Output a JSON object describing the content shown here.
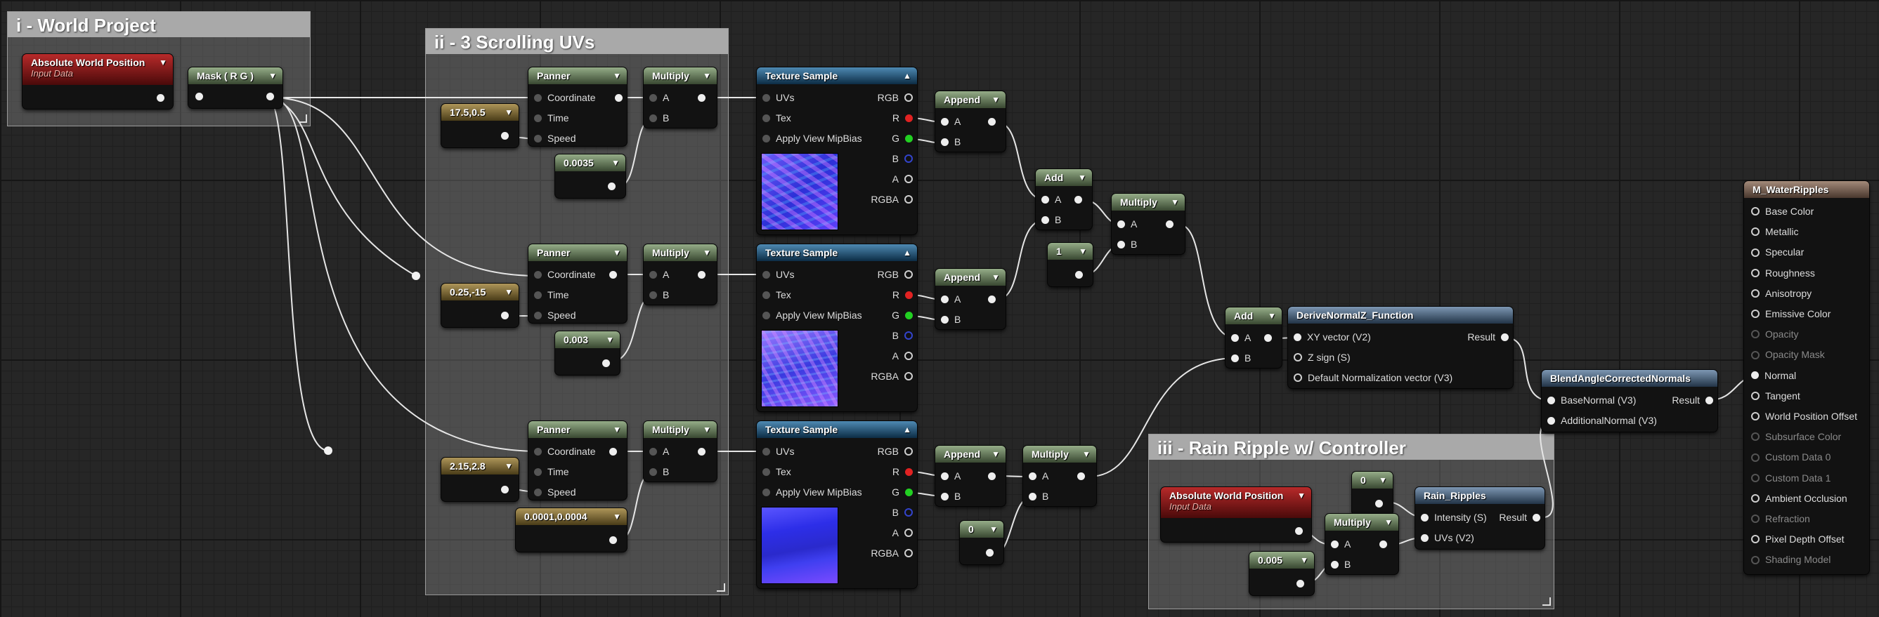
{
  "comments": {
    "world": "i - World Project",
    "scroll": "ii - 3 Scrolling UVs",
    "rain": "iii - Rain Ripple w/ Controller"
  },
  "labels": {
    "absolute_world_position": "Absolute World Position",
    "input_data": "Input Data",
    "mask": "Mask ( R G )",
    "panner": "Panner",
    "multiply": "Multiply",
    "texture_sample": "Texture Sample",
    "append": "Append",
    "add": "Add",
    "coordinate": "Coordinate",
    "time": "Time",
    "speed": "Speed",
    "a": "A",
    "b": "B",
    "uvs": "UVs",
    "tex": "Tex",
    "apply_view_mipbias": "Apply View MipBias",
    "rgb": "RGB",
    "r": "R",
    "g": "G",
    "rgba": "RGBA"
  },
  "constants": {
    "panner1_speed": "17.5,0.5",
    "panner2_speed": "0.25,-15",
    "panner3_speed": "2.15,2.8",
    "mult1_b": "0.0035",
    "mult2_b": "0.003",
    "mult3_b": "0.0001,0.0004",
    "one": "1",
    "zero_a": "0",
    "zero_b": "0",
    "rain_mult": "0.005"
  },
  "derive": {
    "title": "DeriveNormalZ_Function",
    "in1": "XY vector (V2)",
    "in2": "Z sign (S)",
    "in3": "Default Normalization vector (V3)",
    "out": "Result"
  },
  "blend": {
    "title": "BlendAngleCorrectedNormals",
    "in1": "BaseNormal (V3)",
    "in2": "AdditionalNormal (V3)",
    "out": "Result"
  },
  "rain_ripples": {
    "title": "Rain_Ripples",
    "in1": "Intensity (S)",
    "in2": "UVs (V2)",
    "out": "Result"
  },
  "material": {
    "title": "M_WaterRipples",
    "pins": [
      "Base Color",
      "Metallic",
      "Specular",
      "Roughness",
      "Anisotropy",
      "Emissive Color",
      "Opacity",
      "Opacity Mask",
      "Normal",
      "Tangent",
      "World Position Offset",
      "Subsurface Color",
      "Custom Data 0",
      "Custom Data 1",
      "Ambient Occlusion",
      "Refraction",
      "Pixel Depth Offset",
      "Shading Model"
    ],
    "disabled": [
      6,
      7,
      11,
      12,
      13,
      15,
      17
    ]
  },
  "colors": {
    "header_green": "#5d7351",
    "header_blue": "#1f5479",
    "header_red": "#8a1717",
    "header_gold": "#7a6a3b",
    "pin_red": "#e12222",
    "pin_green": "#22d022",
    "pin_blue": "#2233dd"
  }
}
